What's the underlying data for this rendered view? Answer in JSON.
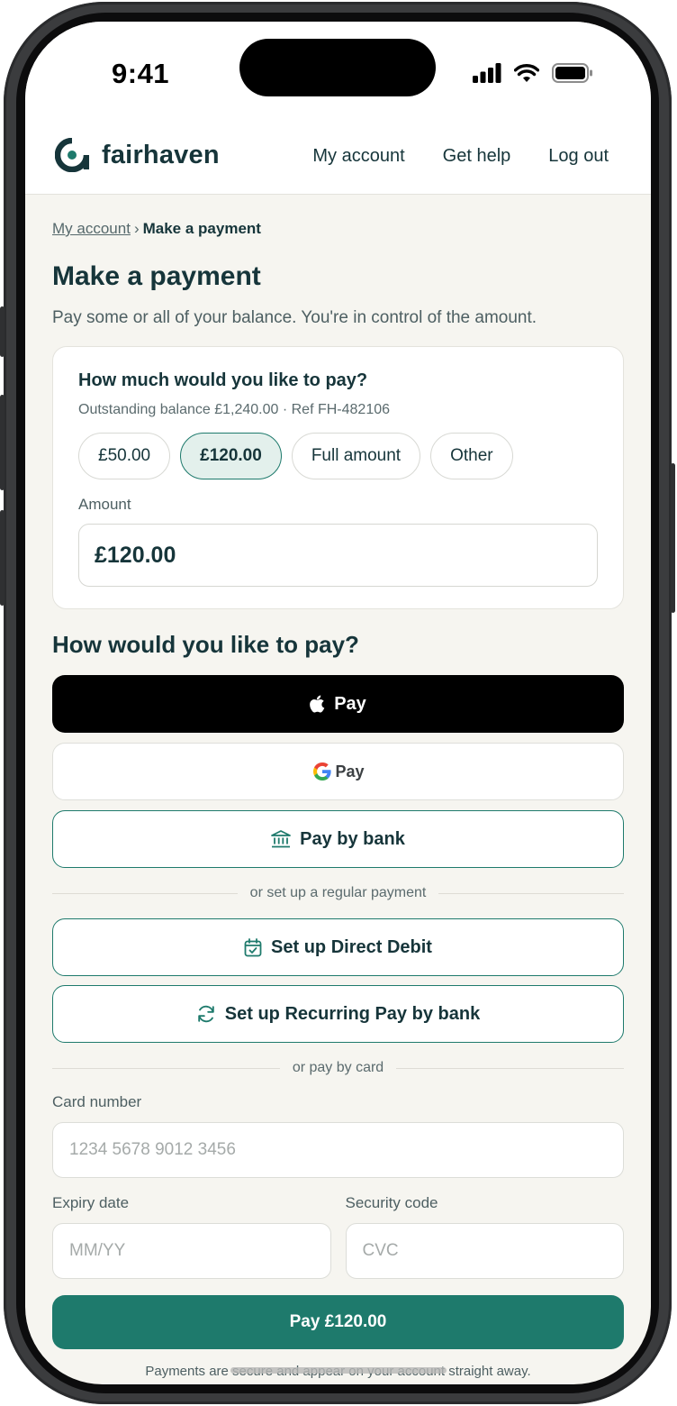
{
  "status_bar": {
    "time": "9:41"
  },
  "brand": {
    "name": "fairhaven",
    "accent_color": "#1e7a6c",
    "logo_icon": "fairhaven-logo-icon"
  },
  "nav": {
    "items": [
      "My account",
      "Get help",
      "Log out"
    ]
  },
  "breadcrumb": {
    "parent": "My account",
    "separator": "›",
    "current": "Make a payment"
  },
  "page": {
    "title": "Make a payment",
    "subtitle": "Pay some or all of your balance. You're in control of the amount."
  },
  "amount_card": {
    "title": "How much would you like to pay?",
    "meta": "Outstanding balance £1,240.00 · Ref FH-482106",
    "chips": [
      "£50.00",
      "£120.00",
      "Full amount",
      "Other"
    ],
    "selected_chip": "£120.00",
    "amount_label": "Amount",
    "amount_value": "£120.00"
  },
  "payment_methods": {
    "title": "How would you like to pay?",
    "apple_pay_label": "Pay",
    "google_pay_label": "Pay",
    "bank_label": "Pay by bank",
    "regular_divider": "or set up a regular payment",
    "direct_debit_label": "Set up Direct Debit",
    "recurring_label": "Set up Recurring Pay by bank",
    "card_divider": "or pay by card"
  },
  "card_form": {
    "card_number_label": "Card number",
    "card_number_placeholder": "1234 5678 9012 3456",
    "expiry_label": "Expiry date",
    "expiry_placeholder": "MM/YY",
    "security_label": "Security code",
    "security_placeholder": "CVC",
    "pay_button": "Pay £120.00",
    "footnote": "Payments are secure and appear on your account straight away."
  }
}
